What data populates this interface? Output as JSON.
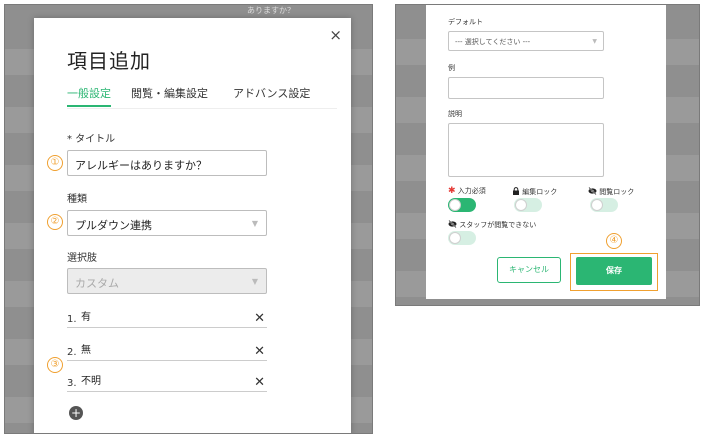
{
  "left": {
    "background_text": "ありますか？",
    "modal": {
      "title": "項目追加",
      "close_icon": "×",
      "tabs": [
        {
          "label": "一般設定",
          "active": true
        },
        {
          "label": "閲覧・編集設定",
          "active": false
        },
        {
          "label": "アドバンス設定",
          "active": false
        }
      ],
      "title_field": {
        "label": "* タイトル",
        "value": "アレルギーはありますか？"
      },
      "type_field": {
        "label": "種類",
        "value": "プルダウン連携"
      },
      "choices_field": {
        "label": "選択肢",
        "value": "カスタム"
      },
      "options": [
        {
          "num": "1.",
          "text": "有"
        },
        {
          "num": "2.",
          "text": "無"
        },
        {
          "num": "3.",
          "text": "不明"
        }
      ],
      "add_icon": "+",
      "select_arrow": "▼",
      "remove_icon": "✕"
    },
    "callouts": [
      "①",
      "②",
      "③"
    ]
  },
  "right": {
    "default_field": {
      "label": "デフォルト",
      "value": "--- 選択してください ---"
    },
    "example_field": {
      "label": "例"
    },
    "description_field": {
      "label": "説明"
    },
    "toggles": [
      {
        "required_mark": "✱",
        "label": "入力必須",
        "state": "on"
      },
      {
        "icon": "lock-icon",
        "label": "編集ロック",
        "state": "off"
      },
      {
        "icon": "eye-slash-icon",
        "label": "閲覧ロック",
        "state": "off"
      },
      {
        "icon": "eye-slash-icon",
        "label": "スタッフが閲覧できない",
        "state": "off"
      }
    ],
    "cancel_label": "キャンセル",
    "save_label": "保存",
    "callout": "④",
    "select_arrow": "▼"
  },
  "colors": {
    "accent": "#2bb673",
    "callout": "#f0a030",
    "required": "#e53935"
  }
}
